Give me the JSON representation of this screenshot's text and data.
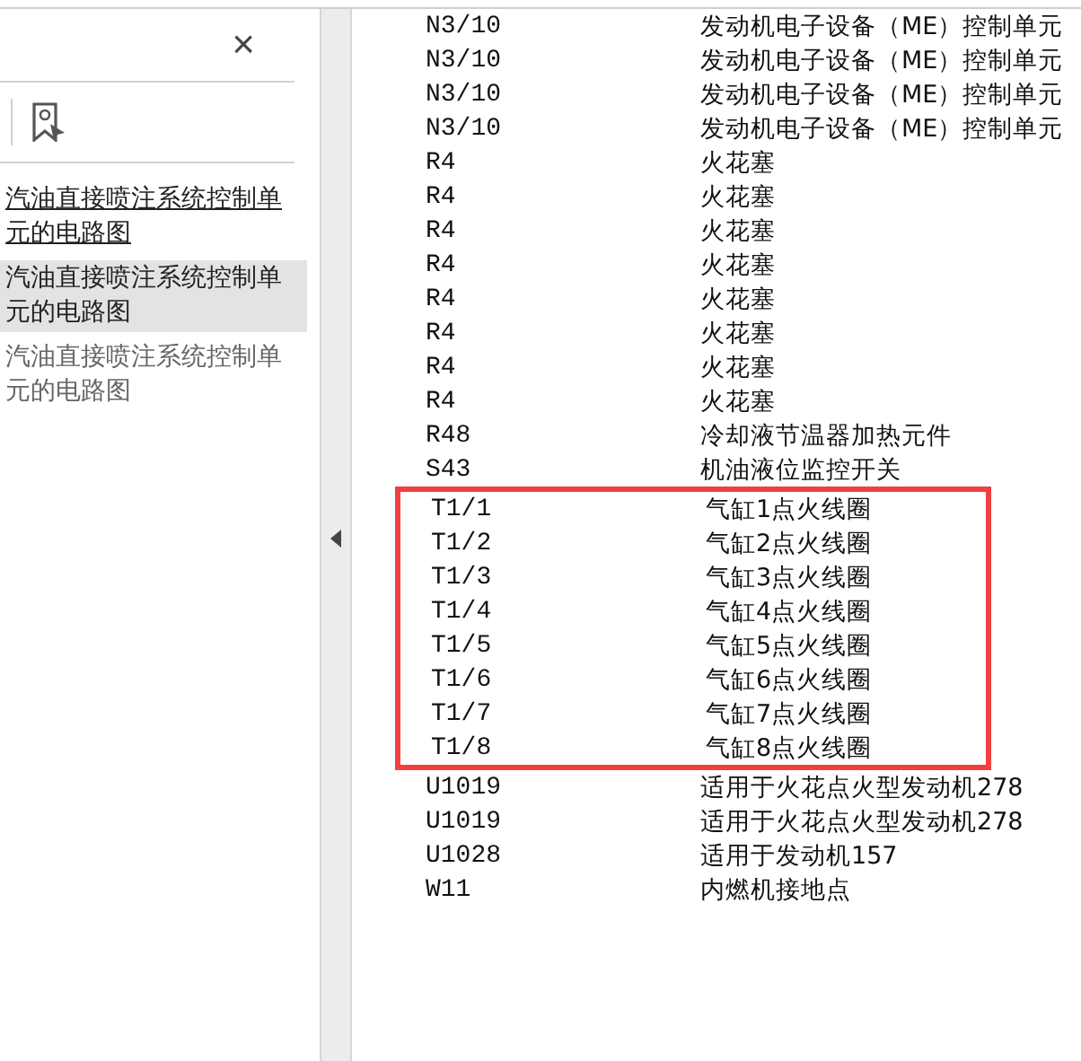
{
  "sidebar": {
    "close": "×",
    "bookmarks": [
      {
        "title": "汽油直接喷注系统控制单元的电路图",
        "selected": false,
        "underlined": true,
        "dimmed": false
      },
      {
        "title": "汽油直接喷注系统控制单元的电路图",
        "selected": true,
        "underlined": false,
        "dimmed": false
      },
      {
        "title": "汽油直接喷注系统控制单元的电路图",
        "selected": false,
        "underlined": false,
        "dimmed": true
      }
    ]
  },
  "document": {
    "rows_before": [
      {
        "code": "N3/10",
        "description": "发动机电子设备（ME）控制单元"
      },
      {
        "code": "N3/10",
        "description": "发动机电子设备（ME）控制单元"
      },
      {
        "code": "N3/10",
        "description": "发动机电子设备（ME）控制单元"
      },
      {
        "code": "N3/10",
        "description": "发动机电子设备（ME）控制单元"
      },
      {
        "code": "R4",
        "description": "火花塞"
      },
      {
        "code": "R4",
        "description": "火花塞"
      },
      {
        "code": "R4",
        "description": "火花塞"
      },
      {
        "code": "R4",
        "description": "火花塞"
      },
      {
        "code": "R4",
        "description": "火花塞"
      },
      {
        "code": "R4",
        "description": "火花塞"
      },
      {
        "code": "R4",
        "description": "火花塞"
      },
      {
        "code": "R4",
        "description": "火花塞"
      },
      {
        "code": "R48",
        "description": "冷却液节温器加热元件"
      },
      {
        "code": "S43",
        "description": "机油液位监控开关"
      }
    ],
    "highlighted_rows": [
      {
        "code": "T1/1",
        "description": "气缸1点火线圈"
      },
      {
        "code": "T1/2",
        "description": "气缸2点火线圈"
      },
      {
        "code": "T1/3",
        "description": "气缸3点火线圈"
      },
      {
        "code": "T1/4",
        "description": "气缸4点火线圈"
      },
      {
        "code": "T1/5",
        "description": "气缸5点火线圈"
      },
      {
        "code": "T1/6",
        "description": "气缸6点火线圈"
      },
      {
        "code": "T1/7",
        "description": "气缸7点火线圈"
      },
      {
        "code": "T1/8",
        "description": "气缸8点火线圈"
      }
    ],
    "rows_after": [
      {
        "code": "U1019",
        "description": "适用于火花点火型发动机278"
      },
      {
        "code": "U1019",
        "description": "适用于火花点火型发动机278"
      },
      {
        "code": "U1028",
        "description": "适用于发动机157"
      },
      {
        "code": "W11",
        "description": "内燃机接地点"
      }
    ]
  }
}
